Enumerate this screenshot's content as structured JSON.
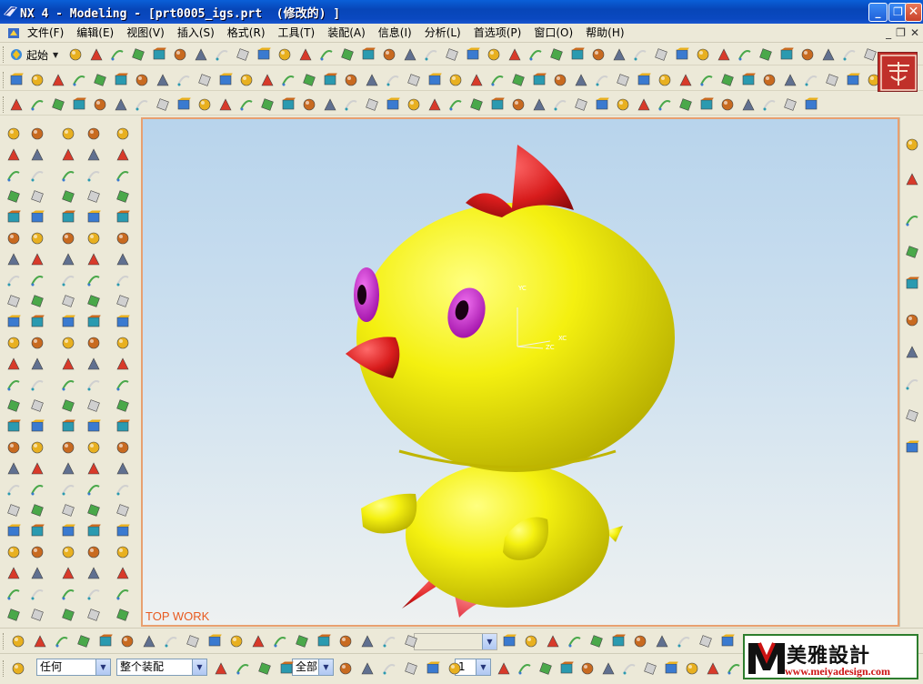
{
  "window": {
    "title": "NX 4 - Modeling - [prt0005_igs.prt  (修改的) ]",
    "minimize_label": "_",
    "restore_label": "❐",
    "close_label": "✕"
  },
  "menu": {
    "items": [
      "文件(F)",
      "编辑(E)",
      "视图(V)",
      "插入(S)",
      "格式(R)",
      "工具(T)",
      "装配(A)",
      "信息(I)",
      "分析(L)",
      "首选项(P)",
      "窗口(O)",
      "帮助(H)"
    ],
    "mdi_minimize": "_",
    "mdi_restore": "❐",
    "mdi_close": "✕"
  },
  "toolbar": {
    "start_label": "起始"
  },
  "viewport": {
    "view_label": "TOP WORK",
    "wcs_labels": [
      "YC",
      "XC",
      "ZC"
    ]
  },
  "bottom": {
    "selection_filter": "任何",
    "selection_scope": "整个装配",
    "layer_value": "全部",
    "grid_value": "1",
    "blank_combo": ""
  },
  "watermark": {
    "brand": "美雅設計",
    "url": "www.meiyadesign.com"
  },
  "colors": {
    "viewport_border": "#e8a070",
    "view_label": "#e85a20",
    "duck_body": "#f0ec10",
    "duck_comb": "#d82020",
    "duck_eye": "#c020c8"
  }
}
